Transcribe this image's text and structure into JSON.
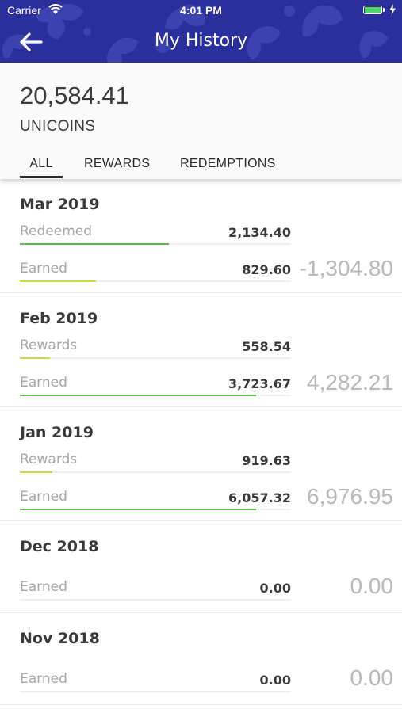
{
  "status_bar": {
    "carrier": "Carrier",
    "time": "4:01 PM",
    "battery_level": 1.0
  },
  "nav": {
    "title": "My History",
    "back_icon": "arrow-left-icon"
  },
  "balance": {
    "amount": "20,584.41",
    "currency": "UNICOINS"
  },
  "tabs": [
    {
      "label": "ALL",
      "active": true
    },
    {
      "label": "REWARDS",
      "active": false
    },
    {
      "label": "REDEMPTIONS",
      "active": false
    }
  ],
  "colors": {
    "nav_blue": "#2a2f9b",
    "earned_bar": "#5fb84a",
    "rewards_bar": "#c6dd3c",
    "redeemed_bar": "#5fb84a"
  },
  "months": [
    {
      "title": "Mar 2019",
      "net": "-1,304.80",
      "rows": [
        {
          "label": "Redeemed",
          "value": "2,134.40",
          "fill": 0.55,
          "kind": "redeemed"
        },
        {
          "label": "Earned",
          "value": "829.60",
          "fill": 0.28,
          "kind": "rewards"
        }
      ]
    },
    {
      "title": "Feb 2019",
      "net": "4,282.21",
      "rows": [
        {
          "label": "Rewards",
          "value": "558.54",
          "fill": 0.11,
          "kind": "rewards"
        },
        {
          "label": "Earned",
          "value": "3,723.67",
          "fill": 0.87,
          "kind": "earned"
        }
      ]
    },
    {
      "title": "Jan 2019",
      "net": "6,976.95",
      "rows": [
        {
          "label": "Rewards",
          "value": "919.63",
          "fill": 0.12,
          "kind": "rewards"
        },
        {
          "label": "Earned",
          "value": "6,057.32",
          "fill": 0.87,
          "kind": "earned"
        }
      ]
    },
    {
      "title": "Dec 2018",
      "net": "0.00",
      "rows": [
        {
          "label": "Earned",
          "value": "0.00",
          "fill": 0,
          "kind": "earned"
        }
      ]
    },
    {
      "title": "Nov 2018",
      "net": "0.00",
      "rows": [
        {
          "label": "Earned",
          "value": "0.00",
          "fill": 0,
          "kind": "earned"
        }
      ]
    }
  ]
}
